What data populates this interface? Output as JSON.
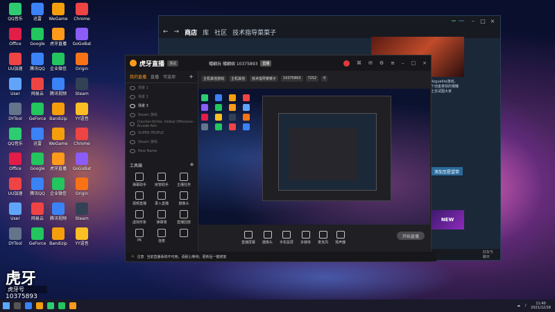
{
  "desktop": {
    "icons": [
      {
        "label": "QQ音乐",
        "color": "#2ecc71"
      },
      {
        "label": "迅雷",
        "color": "#3b82f6"
      },
      {
        "label": "WeGame",
        "color": "#f59e0b"
      },
      {
        "label": "Chrome",
        "color": "#ef4444"
      },
      {
        "label": "Office",
        "color": "#e11d48"
      },
      {
        "label": "Google",
        "color": "#22c55e"
      },
      {
        "label": "虎牙直播",
        "color": "#ff9a1a"
      },
      {
        "label": "GoGoBat",
        "color": "#8b5cf6"
      },
      {
        "label": "UU加速",
        "color": "#ef4444"
      },
      {
        "label": "腾讯QQ",
        "color": "#3b82f6"
      },
      {
        "label": "企业微信",
        "color": "#22c55e"
      },
      {
        "label": "Origin",
        "color": "#f97316"
      },
      {
        "label": "User",
        "color": "#60a5fa"
      },
      {
        "label": "网易云",
        "color": "#ef4444"
      },
      {
        "label": "腾讯视频",
        "color": "#3b82f6"
      },
      {
        "label": "Steam",
        "color": "#334155"
      },
      {
        "label": "DYTool",
        "color": "#64748b"
      },
      {
        "label": "GeForce",
        "color": "#22c55e"
      },
      {
        "label": "Bandizip",
        "color": "#f59e0b"
      },
      {
        "label": "YY语音",
        "color": "#fbbf24"
      }
    ]
  },
  "steam": {
    "badge": "",
    "user": "",
    "nav": {
      "store": "商店",
      "library": "库",
      "community": "社区",
      "username": "技术指导菜菜子"
    },
    "side_text": "Roguelite游戏。\n个动金章钗的钢魄\n土去试图大家",
    "wishlist_button": "添加至愿望单",
    "promo_label": "NEW",
    "bottom_text": "好友与\n聊天"
  },
  "huya": {
    "logo": "虎牙直播",
    "version": "测试",
    "streamer": "幡翩玩 幡翩娱 10375893",
    "streamer_tag": "直播",
    "room_tags": [
      "主机其他游戏",
      "主机其他",
      "技术指导菜菜子",
      "10375893",
      "7252",
      "0"
    ],
    "tabs": {
      "active": "我的直播",
      "second": "直播",
      "third": "可选项"
    },
    "scenes": [
      {
        "label": "场景 1",
        "on": false
      },
      {
        "label": "场景 2",
        "on": false
      },
      {
        "label": "场景 3",
        "on": true
      },
      {
        "label": "Steam 游戏",
        "on": false
      },
      {
        "label": "Counter-Strike: Global Offensive - Arcade Aim",
        "on": false
      },
      {
        "label": "SUPER PEOPLE",
        "on": false
      },
      {
        "label": "Steam 游戏",
        "on": false
      },
      {
        "label": "New Name",
        "on": false
      }
    ],
    "tools_title": "工具箱",
    "tools": [
      "弹幕助手",
      "房管助手",
      "主播任务",
      "视频直播",
      "录入直播",
      "摄像头",
      "虚拟形象",
      "弹幕墙",
      "直播回放",
      "PK",
      "连麦",
      ""
    ],
    "controls": [
      "直播屏幕",
      "摄像头",
      "手机投屏",
      "多媒体",
      "麦克风",
      "扬声器"
    ],
    "start_live": "开始直播",
    "footer_warn": "注意",
    "footer_text": "当前直播系统不可用，请耐心等待；更新后一键修复"
  },
  "overlay": {
    "symbol": "虎牙",
    "name": "虎牙号",
    "number": "10375893"
  },
  "taskbar": {
    "time": "11:40",
    "date": "2021/12/18"
  }
}
